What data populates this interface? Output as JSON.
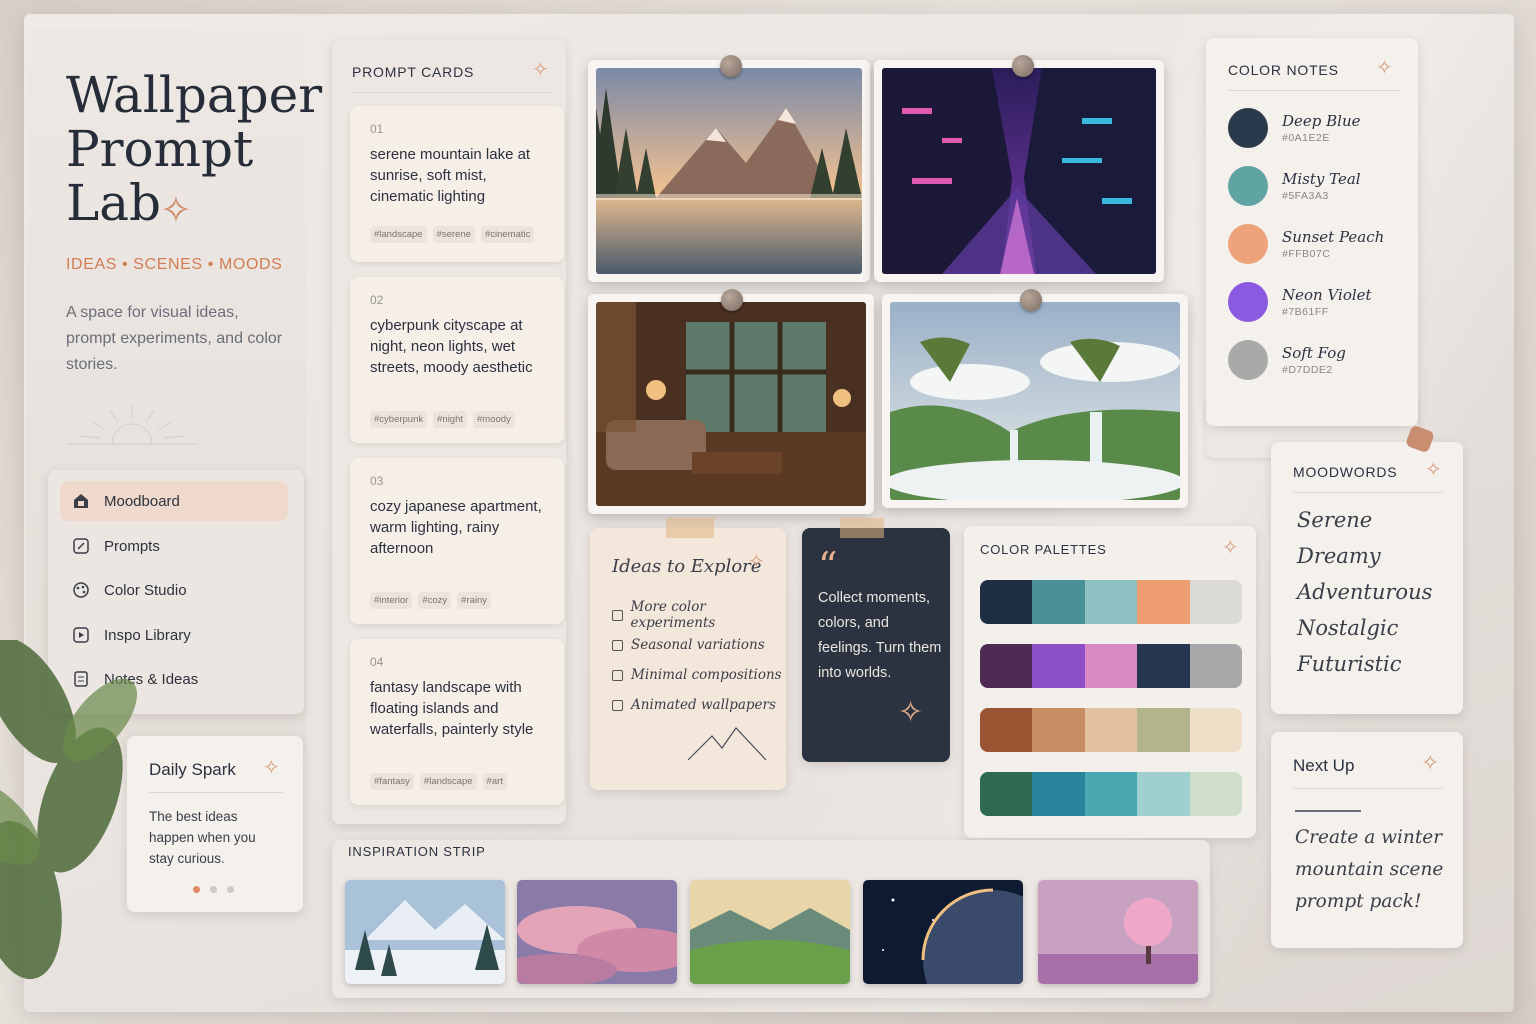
{
  "brand": {
    "title_line1": "Wallpaper",
    "title_line2": "Prompt",
    "title_line3": "Lab",
    "tagline": "IDEAS • SCENES • MOODS",
    "intro": "A space for visual ideas, prompt experiments, and color stories."
  },
  "nav": {
    "items": [
      {
        "label": "Moodboard",
        "icon": "moodboard-icon",
        "active": true
      },
      {
        "label": "Prompts",
        "icon": "prompts-icon"
      },
      {
        "label": "Color Studio",
        "icon": "palette-icon"
      },
      {
        "label": "Inspo Library",
        "icon": "library-icon"
      },
      {
        "label": "Notes & Ideas",
        "icon": "notes-icon"
      }
    ]
  },
  "daily_spark": {
    "title": "Daily Spark",
    "text": "The best ideas happen when you stay curious."
  },
  "prompt_cards": {
    "title": "PROMPT CARDS",
    "cards": [
      {
        "num": "01",
        "text": "serene mountain lake at sunrise, soft mist, cinematic lighting",
        "tags": [
          "#landscape",
          "#serene",
          "#cinematic"
        ]
      },
      {
        "num": "02",
        "text": "cyberpunk cityscape at night, neon lights, wet streets, moody aesthetic",
        "tags": [
          "#cyberpunk",
          "#night",
          "#moody"
        ]
      },
      {
        "num": "03",
        "text": "cozy japanese apartment, warm lighting, rainy afternoon",
        "tags": [
          "#interior",
          "#cozy",
          "#rainy"
        ]
      },
      {
        "num": "04",
        "text": "fantasy landscape with floating islands and waterfalls, painterly style",
        "tags": [
          "#fantasy",
          "#landscape",
          "#art"
        ]
      }
    ]
  },
  "ideas": {
    "title": "Ideas to Explore",
    "items": [
      "More color experiments",
      "Seasonal variations",
      "Minimal compositions",
      "Animated wallpapers"
    ]
  },
  "quote": {
    "mark": "“",
    "text": "Collect moments, colors, and feelings. Turn them into worlds."
  },
  "color_palettes": {
    "title": "COLOR PALETTES",
    "rows": [
      [
        "#1e2e40",
        "#4a8f98",
        "#8fc0c2",
        "#ee9d70",
        "#dcdad7"
      ],
      [
        "#4e2a55",
        "#8d4fc8",
        "#d98ac4",
        "#263650",
        "#a8a8aa"
      ],
      [
        "#9a5532",
        "#c98d66",
        "#e2c1a0",
        "#b2b58c",
        "#efdfc8"
      ],
      [
        "#2e6a50",
        "#27849a",
        "#4aa8b3",
        "#9fcfcf",
        "#cfdecb"
      ]
    ]
  },
  "inspiration_strip": {
    "title": "INSPIRATION STRIP"
  },
  "color_notes": {
    "title": "COLOR NOTES",
    "swatches": [
      {
        "name": "Deep Blue",
        "hex": "#0A1E2E",
        "color": "#2a3a4c"
      },
      {
        "name": "Misty Teal",
        "hex": "#5FA3A3",
        "color": "#5fa3a3"
      },
      {
        "name": "Sunset Peach",
        "hex": "#FFB07C",
        "color": "#eea37a"
      },
      {
        "name": "Neon Violet",
        "hex": "#7B61FF",
        "color": "#8a5ae0"
      },
      {
        "name": "Soft Fog",
        "hex": "#D7DDE2",
        "color": "#a9a8a8"
      }
    ]
  },
  "moodwords": {
    "title": "MOODWORDS",
    "words": [
      "Serene",
      "Dreamy",
      "Adventurous",
      "Nostalgic",
      "Futuristic"
    ]
  },
  "next_up": {
    "title": "Next Up",
    "text": "Create a winter mountain scene prompt pack!"
  },
  "colors": {
    "accent": "#d27c52",
    "nav_active": "#efd9cc",
    "quote_bg": "#2b3340"
  }
}
